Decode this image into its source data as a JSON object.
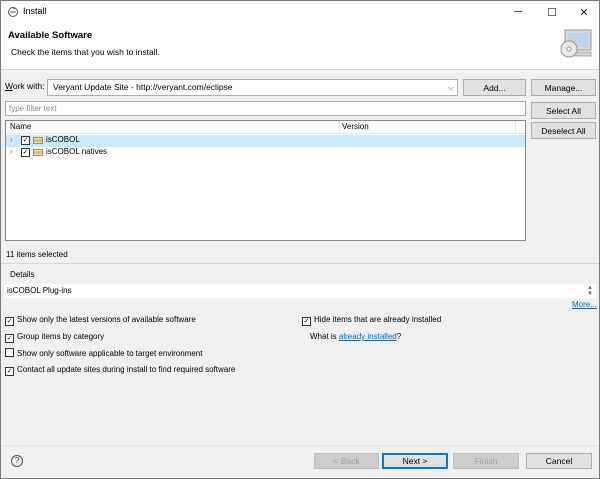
{
  "window": {
    "title": "Install",
    "controls": {
      "minimize": "─",
      "maximize": "☐",
      "close": "✕"
    }
  },
  "banner": {
    "heading": "Available Software",
    "description": "Check the items that you wish to install."
  },
  "work_with": {
    "label_prefix": "W",
    "label_rest": "ork with:",
    "value": "Veryant Update Site - http://veryant.com/eclipse",
    "dropdown_glyph": "⌵"
  },
  "buttons": {
    "add": "Add...",
    "manage": "Manage...",
    "select_all": "Select All",
    "deselect_all": "Deselect All",
    "back": "< Back",
    "next": "Next >",
    "finish": "Finish",
    "cancel": "Cancel"
  },
  "filter": {
    "placeholder": "type filter text"
  },
  "tree": {
    "columns": [
      "Name",
      "Version"
    ],
    "rows": [
      {
        "name": "isCOBOL",
        "version": "",
        "checked": true,
        "selected": true
      },
      {
        "name": "isCOBOL natives",
        "version": "",
        "checked": true,
        "selected": false
      }
    ]
  },
  "status": "11 items selected",
  "details": {
    "label": "Details",
    "text": "isCOBOL Plug-ins",
    "more_link": "More..."
  },
  "options": {
    "show_latest": {
      "label": "Show only the latest versions of available software",
      "checked": true
    },
    "group_by_category": {
      "label": "Group items by category",
      "checked": true
    },
    "applicable_only": {
      "label": "Show only software applicable to target environment",
      "checked": false
    },
    "contact_all_sites": {
      "label": "Contact all update sites during install to find required software",
      "checked": true
    },
    "hide_installed": {
      "label": "Hide items that are already installed",
      "checked": true
    },
    "what_is_prefix": "What is ",
    "already_installed_link": "already installed",
    "what_is_suffix": "?"
  },
  "glyphs": {
    "check": "✓",
    "twisty": "›",
    "help": "?"
  }
}
